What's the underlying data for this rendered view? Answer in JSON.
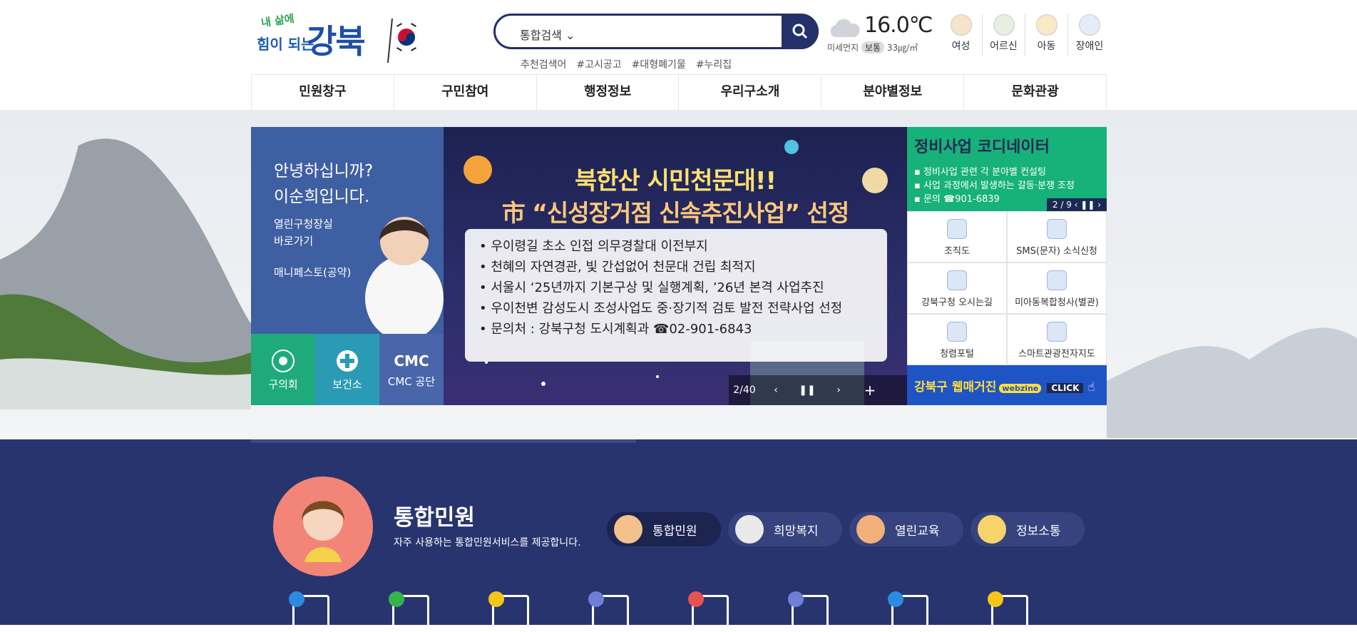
{
  "header": {
    "logo": {
      "line1": "내 삶에",
      "line2": "힘이 되는",
      "name": "강북"
    },
    "search": {
      "scope": "통합검색",
      "placeholder": ""
    },
    "recommend": {
      "label": "추천검색어",
      "tags": [
        "#고시공고",
        "#대형폐기물",
        "#누리집"
      ]
    },
    "weather": {
      "temp": "16.0℃",
      "dust_label": "미세먼지",
      "dust_level": "보통",
      "dust_value": "33㎍/㎥"
    },
    "persona": [
      "여성",
      "어르신",
      "아동",
      "장애인"
    ]
  },
  "gnb": [
    "민원창구",
    "구민참여",
    "행정정보",
    "우리구소개",
    "분야별정보",
    "문화관광"
  ],
  "mayor": {
    "greeting1": "안녕하십니까?",
    "greeting2": "이순희입니다.",
    "link1a": "열린구청장실",
    "link1b": "바로가기",
    "link2": "매니페스토(공약)"
  },
  "quick": [
    {
      "label": "구의회",
      "color": "#1faa7b"
    },
    {
      "label": "보건소",
      "color": "#2b9bb5"
    },
    {
      "label": "CMC 공단",
      "big": "CMC",
      "color": "#4966aa"
    }
  ],
  "banner": {
    "title1": "북한산 시민천문대!!",
    "title2": "市 “신성장거점 신속추진사업” 선정",
    "bullets": [
      "• 우이령길 초소 인접 의무경찰대 이전부지",
      "• 천혜의 자연경관, 빛 간섭없어 천문대 건립 최적지",
      "• 서울시 ‘25년까지 기본구상 및 실행계획, ’26년 본격 사업추진",
      "• 우이천변 감성도시 조성사업도 중·장기적 검토 발전 전략사업 선정",
      "• 문의처 : 강북구청 도시계획과 ☎02-901-6843"
    ],
    "counter": "2/40"
  },
  "side": {
    "title": "정비사업 코디네이터",
    "items": [
      "▪ 정비사업 관련 각 분야별 컨설팅",
      "▪ 사업 과정에서 발생하는 갈등·분쟁 조정",
      "▪ 문의 ☎901-6839"
    ],
    "page": "2 / 9",
    "grid": [
      "조직도",
      "SMS(문자) 소식신청",
      "강북구청 오시는길",
      "미아동복합청사(별관)",
      "청렴포털",
      "스마트관광전자지도"
    ],
    "webzine": "강북구 웹매거진",
    "webzine_tag": "webzine",
    "click": "CLICK"
  },
  "civil": {
    "title": "통합민원",
    "subtitle": "자주 사용하는 통합민원서비스를 제공합니다.",
    "tabs": [
      "통합민원",
      "희망복지",
      "열린교육",
      "정보소통"
    ],
    "active_tab": "통합민원"
  }
}
